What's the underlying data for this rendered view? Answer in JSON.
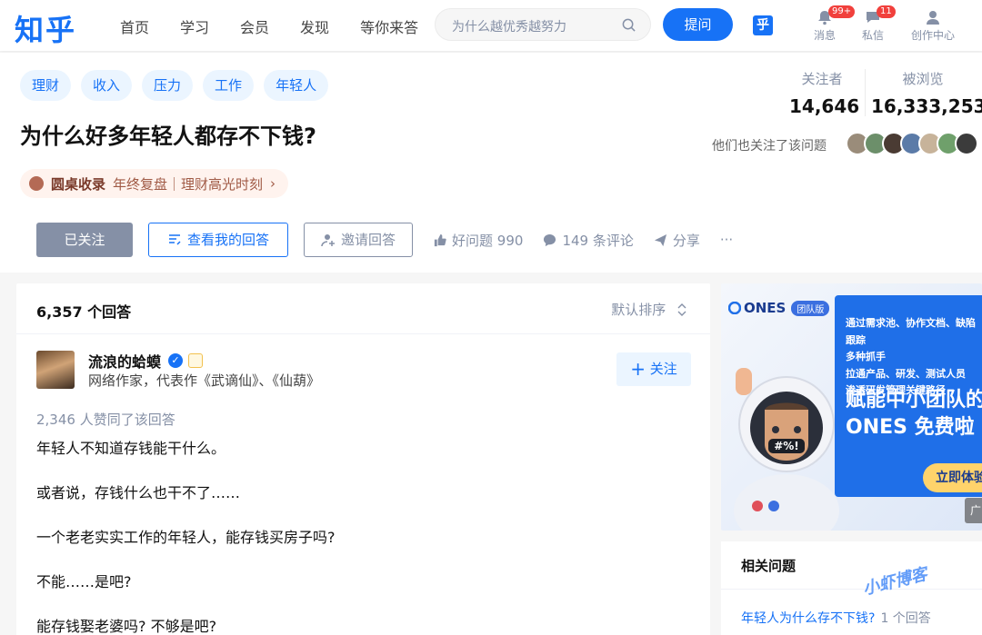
{
  "header": {
    "logo": "知乎",
    "nav": [
      "首页",
      "学习",
      "会员",
      "发现",
      "等你来答"
    ],
    "search_placeholder": "为什么越优秀越努力",
    "ask_label": "提问",
    "hu_label": "乎",
    "tools": [
      {
        "label": "消息",
        "badge": "99+"
      },
      {
        "label": "私信",
        "badge": "11"
      },
      {
        "label": "创作中心"
      }
    ]
  },
  "question": {
    "tags": [
      "理财",
      "收入",
      "压力",
      "工作",
      "年轻人"
    ],
    "title": "为什么好多年轻人都存不下钱?",
    "roundtable": {
      "title": "圆桌收录",
      "desc": "年终复盘｜理财高光时刻",
      "arrow": "›"
    },
    "followers_label": "关注者",
    "followers": "14,646",
    "views_label": "被浏览",
    "views": "16,333,253",
    "also_follow": "他们也关注了该问题",
    "actions": {
      "followed": "已关注",
      "view_my_answer": "查看我的回答",
      "invite": "邀请回答",
      "good_question": "好问题 990",
      "comments": "149 条评论",
      "share": "分享",
      "more": "···"
    }
  },
  "answers": {
    "count": "6,357 个回答",
    "sort": "默认排序",
    "author": {
      "name": "流浪的蛤蟆",
      "desc": "网络作家，代表作《武谪仙》、《仙葫》",
      "follow": "关注"
    },
    "likes": "2,346 人赞同了该回答",
    "paragraphs": [
      "年轻人不知道存钱能干什么。",
      "或者说，存钱什么也干不了……",
      "一个老老实实工作的年轻人，能存钱买房子吗?",
      "不能……是吧?",
      "能存钱娶老婆吗? 不够是吧?"
    ]
  },
  "ad": {
    "brand": "ONES",
    "brand_tag": "团队版",
    "lines": [
      "通过需求池、协作文档、缺陷跟踪",
      "多种抓手",
      "拉通产品、研发、测试人员",
      "渗透研发管理关键路径"
    ],
    "headline1": "赋能中小团队的",
    "headline2": "ONES 免费啦",
    "cta": "立即体验",
    "ad_mark": "广",
    "mascot_text": "#%!"
  },
  "related": {
    "title": "相关问题",
    "item": "年轻人为什么存不下钱?",
    "item_count": "1 个回答"
  },
  "watermark": "小虾博客",
  "colors": {
    "brand": "#1772f6",
    "followed": "#8590a6",
    "badge": "#f1403c"
  }
}
